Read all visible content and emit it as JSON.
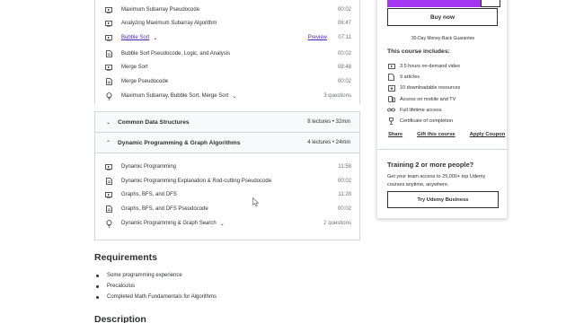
{
  "section1": {
    "lectures": [
      {
        "icon": "video-icon",
        "title": "Maximum Subarray Pseudocode",
        "meta": "00:02"
      },
      {
        "icon": "video-icon",
        "title": "Analyzing Maximum Subarray Algorithm",
        "meta": "06:47"
      },
      {
        "icon": "video-icon",
        "title": "Bubble Sort",
        "preview": "Preview",
        "meta": "07:11"
      },
      {
        "icon": "document-icon",
        "title": "Bubble Sort Pseudocode, Logic, and Analysis",
        "meta": "00:02"
      },
      {
        "icon": "video-icon",
        "title": "Merge Sort",
        "meta": "08:48"
      },
      {
        "icon": "document-icon",
        "title": "Merge Pseudocode",
        "meta": "00:02"
      },
      {
        "icon": "quiz-icon",
        "title": "Maximum Subarray, Bubble Sort, Merge Sort",
        "meta": "3 questions"
      }
    ]
  },
  "section2": {
    "title": "Common Data Structures",
    "meta": "8 lectures • 32min"
  },
  "section3": {
    "title": "Dynamic Programming & Graph Algorithms",
    "meta": "4 lectures • 24min",
    "lectures": [
      {
        "icon": "video-icon",
        "title": "Dynamic Programming",
        "meta": "11:58"
      },
      {
        "icon": "document-icon",
        "title": "Dynamic Programming Explanation & Rod-cutting Pseudocode",
        "meta": "00:02"
      },
      {
        "icon": "video-icon",
        "title": "Graphs, BFS, and DFS",
        "meta": "11:28"
      },
      {
        "icon": "document-icon",
        "title": "Graphs, BFS, and DFS Pseudocode",
        "meta": "00:02"
      },
      {
        "icon": "quiz-icon",
        "title": "Dynamic Programming & Graph Search",
        "meta": "2 questions"
      }
    ]
  },
  "requirements": {
    "title": "Requirements",
    "items": [
      "Some programming experience",
      "Precalculus",
      "Completed Math Fundamentals for Algorithms"
    ]
  },
  "description": {
    "title": "Description"
  },
  "sidebar": {
    "buy_now": "Buy now",
    "guarantee": "30-Day Money-Back Guarantee",
    "includes_title": "This course includes:",
    "includes": [
      {
        "icon": "video-icon",
        "text": "3.5 hours on-demand video"
      },
      {
        "icon": "file-icon",
        "text": "9 articles"
      },
      {
        "icon": "download-icon",
        "text": "10 downloadable resources"
      },
      {
        "icon": "mobile-tv-icon",
        "text": "Access on mobile and TV"
      },
      {
        "icon": "infinity-icon",
        "text": "Full lifetime access"
      },
      {
        "icon": "trophy-icon",
        "text": "Certificate of completion"
      }
    ],
    "share": "Share",
    "gift": "Gift this course",
    "coupon": "Apply Coupon",
    "train_title": "Training 2 or more people?",
    "train_text": "Get your team access to 25,000+ top Udemy courses anytime, anywhere.",
    "try_business": "Try Udemy Business"
  },
  "colors": {
    "accent": "#a435f0",
    "link": "#5022c3",
    "border": "#d1d7dc",
    "section_bg": "#f7f9fa"
  }
}
